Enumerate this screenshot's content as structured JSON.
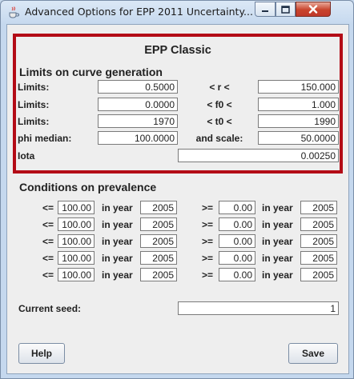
{
  "window": {
    "title": "Advanced Options for EPP 2011 Uncertainty...",
    "minimize_icon": "minimize-icon",
    "maximize_icon": "maximize-icon",
    "close_icon": "close-icon",
    "app_icon": "java-cup-icon"
  },
  "epp_classic": {
    "heading": "EPP Classic",
    "section": "Limits on curve generation",
    "rows": [
      {
        "label": "Limits:",
        "low": "0.5000",
        "mid": "< r <",
        "high": "150.000"
      },
      {
        "label": "Limits:",
        "low": "0.0000",
        "mid": "< f0 <",
        "high": "1.000"
      },
      {
        "label": "Limits:",
        "low": "1970",
        "mid": "< t0 <",
        "high": "1990"
      },
      {
        "label": "phi median:",
        "low": "100.0000",
        "mid": "and scale:",
        "high": "50.0000"
      }
    ],
    "iota_label": "Iota",
    "iota_value": "0.00250"
  },
  "prevalence": {
    "heading": "Conditions on prevalence",
    "le": "<=",
    "ge": ">=",
    "in_year": "in year",
    "rows": [
      {
        "le_val": "100.00",
        "le_year": "2005",
        "ge_val": "0.00",
        "ge_year": "2005"
      },
      {
        "le_val": "100.00",
        "le_year": "2005",
        "ge_val": "0.00",
        "ge_year": "2005"
      },
      {
        "le_val": "100.00",
        "le_year": "2005",
        "ge_val": "0.00",
        "ge_year": "2005"
      },
      {
        "le_val": "100.00",
        "le_year": "2005",
        "ge_val": "0.00",
        "ge_year": "2005"
      },
      {
        "le_val": "100.00",
        "le_year": "2005",
        "ge_val": "0.00",
        "ge_year": "2005"
      }
    ]
  },
  "seed": {
    "label": "Current seed:",
    "value": "1"
  },
  "buttons": {
    "help": "Help",
    "save": "Save"
  },
  "colors": {
    "panel_border": "#b30b16",
    "close_button": "#c8442c"
  }
}
